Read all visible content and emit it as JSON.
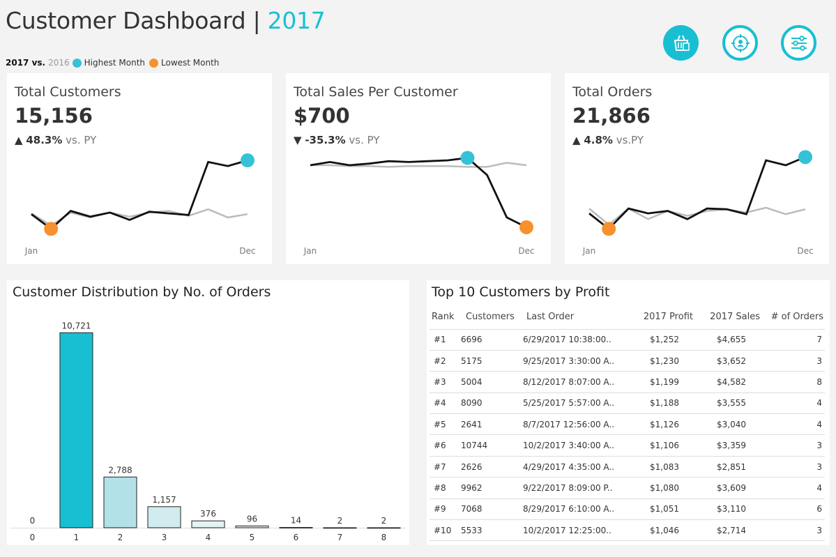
{
  "header": {
    "title": "Customer Dashboard | ",
    "year": "2017",
    "legend": {
      "current": "2017 vs.",
      "previous": "2016",
      "highest": "Highest Month",
      "lowest": "Lowest Month"
    },
    "icons": [
      "shopping-basket-icon",
      "customer-target-icon",
      "filter-sliders-icon"
    ]
  },
  "colors": {
    "accent": "#1abfd2",
    "highest": "#35c2d6",
    "lowest": "#f7902e",
    "current_line": "#111111",
    "previous_line": "#bbbbbb",
    "bar_main": "#18bfd3",
    "bar_light": "#b2e2e8"
  },
  "kpis": [
    {
      "title": "Total Customers",
      "value": "15,156",
      "arrow": "▲",
      "change": "48.3%",
      "vs": "vs. PY",
      "x_start": "Jan",
      "x_end": "Dec",
      "current": [
        0.28,
        0.1,
        0.32,
        0.25,
        0.3,
        0.21,
        0.31,
        0.29,
        0.27,
        0.92,
        0.87,
        0.94
      ],
      "previous": [
        0.29,
        0.14,
        0.3,
        0.24,
        0.3,
        0.25,
        0.3,
        0.32,
        0.26,
        0.34,
        0.24,
        0.28
      ],
      "highest_index": 11,
      "lowest_index": 1
    },
    {
      "title": "Total Sales Per Customer",
      "value": "$700",
      "arrow": "▼",
      "change": "-35.3%",
      "vs": "vs. PY",
      "x_start": "Jan",
      "x_end": "Dec",
      "current": [
        0.88,
        0.92,
        0.88,
        0.9,
        0.93,
        0.92,
        0.93,
        0.94,
        0.97,
        0.76,
        0.24,
        0.12
      ],
      "previous": [
        0.88,
        0.88,
        0.87,
        0.87,
        0.86,
        0.87,
        0.87,
        0.87,
        0.86,
        0.86,
        0.91,
        0.88
      ],
      "highest_index": 8,
      "lowest_index": 11
    },
    {
      "title": "Total Orders",
      "value": "21,866",
      "arrow": "▲",
      "change": "4.8%",
      "vs": "vs.PY",
      "x_start": "Jan",
      "x_end": "Dec",
      "current": [
        0.29,
        0.1,
        0.35,
        0.29,
        0.32,
        0.22,
        0.35,
        0.34,
        0.28,
        0.94,
        0.88,
        0.98
      ],
      "previous": [
        0.35,
        0.15,
        0.35,
        0.22,
        0.32,
        0.26,
        0.32,
        0.34,
        0.3,
        0.36,
        0.28,
        0.34
      ],
      "highest_index": 11,
      "lowest_index": 1
    }
  ],
  "distribution": {
    "title": "Customer Distribution by No. of Orders"
  },
  "chart_data": {
    "type": "bar",
    "title": "Customer Distribution by No. of Orders",
    "categories": [
      "0",
      "1",
      "2",
      "3",
      "4",
      "5",
      "6",
      "7",
      "8"
    ],
    "values": [
      0,
      10721,
      2788,
      1157,
      376,
      96,
      14,
      2,
      2
    ],
    "labels": [
      "0",
      "10,721",
      "2,788",
      "1,157",
      "376",
      "96",
      "14",
      "2",
      "2"
    ],
    "fill_colors": [
      "#18bfd3",
      "#18bfd3",
      "#b2e2e8",
      "#d2ebef",
      "#e3f2f4",
      "#ecf6f8",
      "#f3f9fa",
      "#f3f9fa",
      "#f3f9fa"
    ],
    "xlabel": "",
    "ylabel": "",
    "ylim": [
      0,
      11000
    ],
    "grid": false
  },
  "top10": {
    "title": "Top 10 Customers by Profit",
    "columns": [
      "Rank",
      "Customers",
      "Last Order",
      "2017 Profit",
      "2017 Sales",
      "# of Orders"
    ],
    "rows": [
      [
        "#1",
        "6696",
        "6/29/2017 10:38:00..",
        "$1,252",
        "$4,655",
        "7"
      ],
      [
        "#2",
        "5175",
        "9/25/2017 3:30:00 A..",
        "$1,230",
        "$3,652",
        "3"
      ],
      [
        "#3",
        "5004",
        "8/12/2017 8:07:00 A..",
        "$1,199",
        "$4,582",
        "8"
      ],
      [
        "#4",
        "8090",
        "5/25/2017 5:57:00 A..",
        "$1,188",
        "$3,555",
        "4"
      ],
      [
        "#5",
        "2641",
        "8/7/2017 12:56:00 A..",
        "$1,126",
        "$3,040",
        "4"
      ],
      [
        "#6",
        "10744",
        "10/2/2017 3:40:00 A..",
        "$1,106",
        "$3,359",
        "3"
      ],
      [
        "#7",
        "2626",
        "4/29/2017 4:35:00 A..",
        "$1,083",
        "$2,851",
        "3"
      ],
      [
        "#8",
        "9962",
        "9/22/2017 8:09:00 P..",
        "$1,080",
        "$3,609",
        "4"
      ],
      [
        "#9",
        "7068",
        "8/29/2017 6:10:00 A..",
        "$1,051",
        "$3,110",
        "6"
      ],
      [
        "#10",
        "5533",
        "10/2/2017 12:25:00..",
        "$1,046",
        "$2,714",
        "3"
      ]
    ]
  }
}
